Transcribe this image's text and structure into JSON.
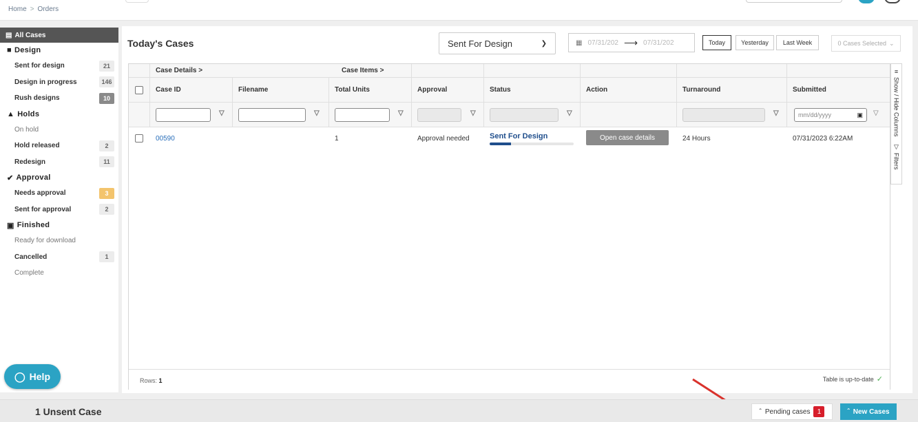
{
  "breadcrumb": {
    "home": "Home",
    "separator": ">",
    "current": "Orders"
  },
  "sidebar": {
    "all_cases": "All Cases",
    "groups": [
      {
        "label": "Design",
        "icon": "folder-icon",
        "items": [
          {
            "label": "Sent for design",
            "count": "21"
          },
          {
            "label": "Design in progress",
            "count": "146"
          },
          {
            "label": "Rush designs",
            "count": "10"
          }
        ]
      },
      {
        "label": "Holds",
        "icon": "warning-icon",
        "items": [
          {
            "label": "On hold",
            "count": ""
          },
          {
            "label": "Hold released",
            "count": "2"
          },
          {
            "label": "Redesign",
            "count": "11"
          }
        ]
      },
      {
        "label": "Approval",
        "icon": "check-circle-icon",
        "items": [
          {
            "label": "Needs approval",
            "count": "3"
          },
          {
            "label": "Sent for approval",
            "count": "2"
          }
        ]
      },
      {
        "label": "Finished",
        "icon": "save-icon",
        "items": [
          {
            "label": "Ready for download",
            "count": ""
          },
          {
            "label": "Cancelled",
            "count": "1"
          },
          {
            "label": "Complete",
            "count": ""
          }
        ]
      }
    ]
  },
  "help": {
    "label": "Help"
  },
  "main": {
    "title": "Today's Cases",
    "status_filter": "Sent For Design",
    "date_from": "07/31/202",
    "date_to": "07/31/202",
    "ranges": [
      "Today",
      "Yesterday",
      "Last Week"
    ],
    "cases_selected": "0 Cases Selected"
  },
  "grid": {
    "group_headers": {
      "case_details": "Case Details  >",
      "case_items": "Case Items  >"
    },
    "columns": [
      "Case ID",
      "Filename",
      "Total Units",
      "Approval",
      "Status",
      "Action",
      "Turnaround",
      "Submitted"
    ],
    "date_placeholder": "mm/dd/yyyy",
    "rows": [
      {
        "case_id": "00590",
        "filename": "",
        "total_units": "1",
        "approval": "Approval needed",
        "status": "Sent For Design",
        "status_progress": 0.25,
        "action": "Open case details",
        "turnaround": "24 Hours",
        "submitted": "07/31/2023 6:22AM"
      }
    ],
    "rows_label": "Rows:",
    "rows_count": "1",
    "up_to_date": "Table is up-to-date",
    "side_tabs": {
      "columns": "Show / Hide Columns",
      "filters": "Filters"
    }
  },
  "bottom": {
    "unsent": "1 Unsent Case",
    "pending_label": "Pending cases",
    "pending_count": "1",
    "new_cases": "New Cases"
  },
  "colors": {
    "accent": "#2ba3c4",
    "status_blue": "#1f4e8c",
    "danger": "#d71e2b",
    "warning": "#f3c46d"
  }
}
